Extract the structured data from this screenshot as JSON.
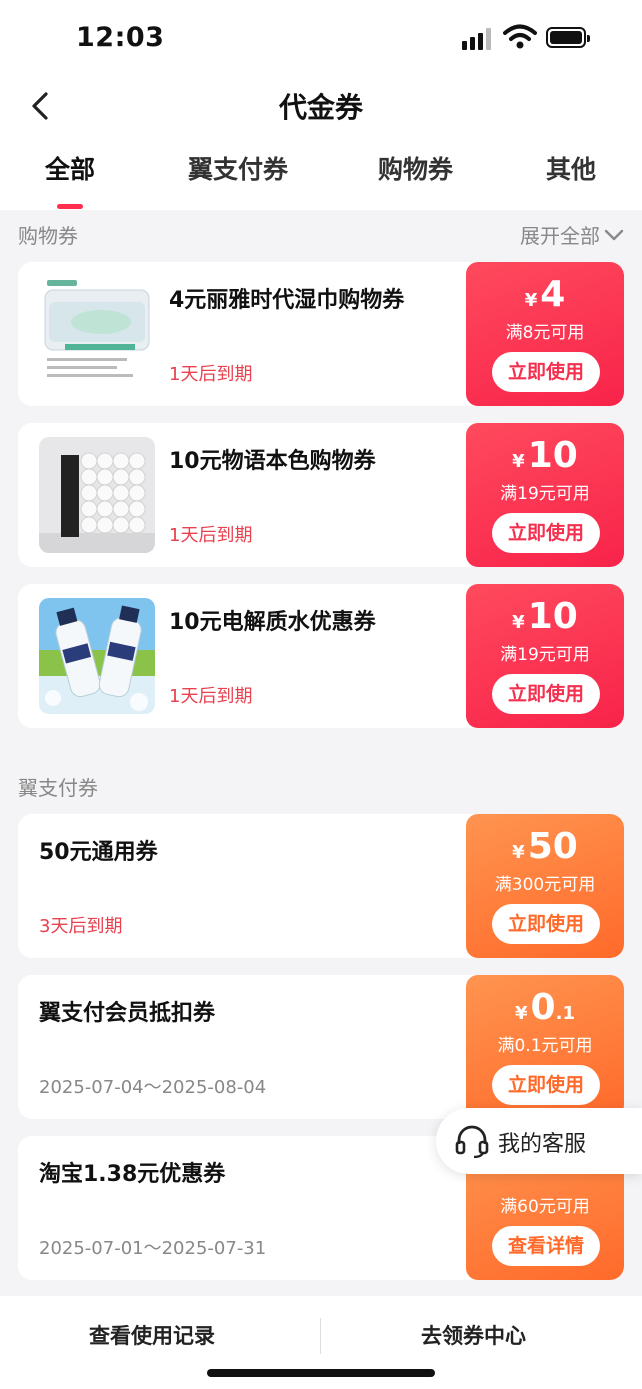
{
  "status": {
    "time": "12:03"
  },
  "nav": {
    "title": "代金券"
  },
  "tabs": [
    "全部",
    "翼支付券",
    "购物券",
    "其他"
  ],
  "sections": {
    "shopping": {
      "title": "购物券",
      "expand_label": "展开全部"
    },
    "yzf": {
      "title": "翼支付券"
    }
  },
  "shopping_coupons": [
    {
      "name": "4元丽雅时代湿巾购物券",
      "expiry": "1天后到期",
      "currency": "¥",
      "amount": "4",
      "condition": "满8元可用",
      "action": "立即使用"
    },
    {
      "name": "10元物语本色购物券",
      "expiry": "1天后到期",
      "currency": "¥",
      "amount": "10",
      "condition": "满19元可用",
      "action": "立即使用"
    },
    {
      "name": "10元电解质水优惠券",
      "expiry": "1天后到期",
      "currency": "¥",
      "amount": "10",
      "condition": "满19元可用",
      "action": "立即使用"
    }
  ],
  "yzf_coupons": [
    {
      "name": "50元通用券",
      "expiry": "3天后到期",
      "currency": "¥",
      "amount": "50",
      "condition": "满300元可用",
      "action": "立即使用"
    },
    {
      "name": "翼支付会员抵扣券",
      "date_range": "2025-07-04～2025-08-04",
      "currency": "¥",
      "amount": "0",
      "amount_decimal": ".1",
      "condition": "满0.1元可用",
      "action": "立即使用"
    },
    {
      "name": "淘宝1.38元优惠券",
      "date_range": "2025-07-01～2025-07-31",
      "condition": "满60元可用",
      "action": "查看详情"
    }
  ],
  "customer_service": {
    "label": "我的客服"
  },
  "bottom": {
    "history": "查看使用记录",
    "center": "去领券中心"
  },
  "colors": {
    "accent_red": "#f8234a",
    "accent_orange": "#ff6a2a",
    "expiry_red": "#e8414f"
  },
  "icons": [
    "back-icon",
    "signal-icon",
    "wifi-icon",
    "battery-icon",
    "chevron-down-icon",
    "headset-icon"
  ]
}
